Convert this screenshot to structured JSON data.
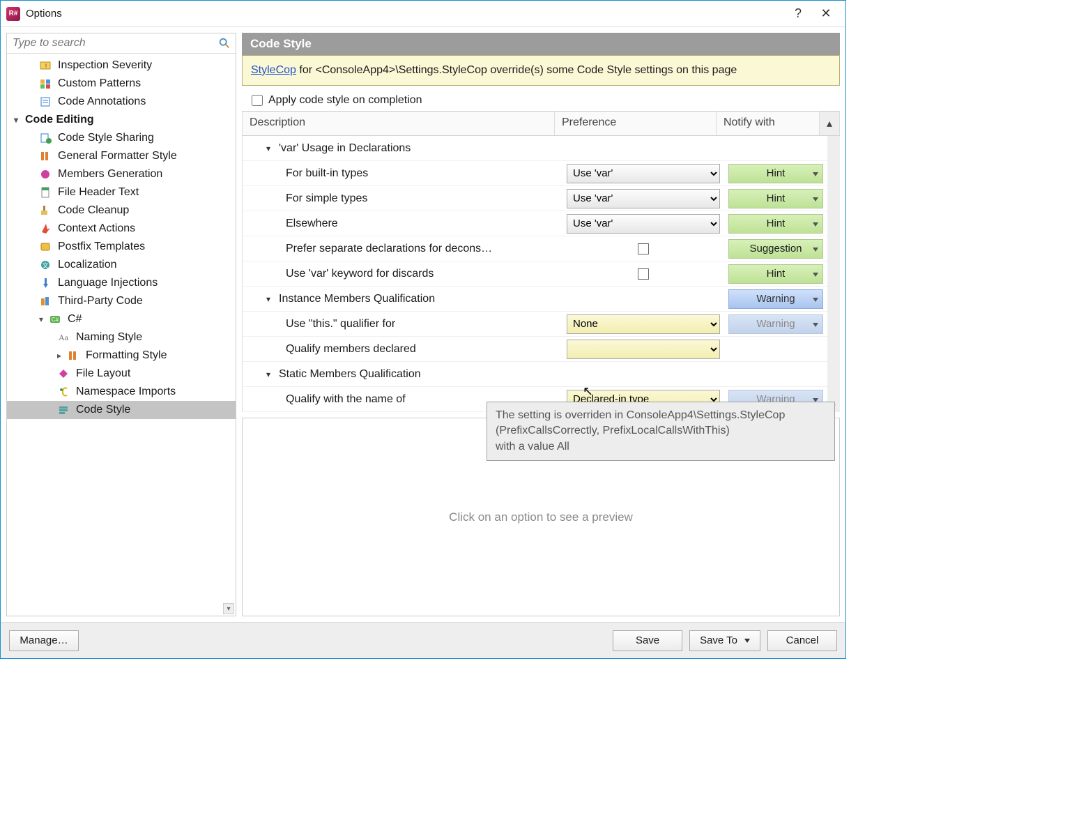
{
  "window": {
    "title": "Options"
  },
  "titlebar": {
    "help": "?",
    "close": "✕"
  },
  "search": {
    "placeholder": "Type to search"
  },
  "tree": {
    "items": [
      {
        "level": 1,
        "label": "Inspection Severity"
      },
      {
        "level": 1,
        "label": "Custom Patterns"
      },
      {
        "level": 1,
        "label": "Code Annotations"
      },
      {
        "group": true,
        "label": "Code Editing",
        "expanded": true
      },
      {
        "level": 1,
        "label": "Code Style Sharing"
      },
      {
        "level": 1,
        "label": "General Formatter Style"
      },
      {
        "level": 1,
        "label": "Members Generation"
      },
      {
        "level": 1,
        "label": "File Header Text"
      },
      {
        "level": 1,
        "label": "Code Cleanup"
      },
      {
        "level": 1,
        "label": "Context Actions"
      },
      {
        "level": 1,
        "label": "Postfix Templates"
      },
      {
        "level": 1,
        "label": "Localization"
      },
      {
        "level": 1,
        "label": "Language Injections"
      },
      {
        "level": 1,
        "label": "Third-Party Code"
      },
      {
        "level": 1,
        "label": "C#",
        "expandable": true,
        "expanded": true
      },
      {
        "level": 2,
        "label": "Naming Style"
      },
      {
        "level": 2,
        "label": "Formatting Style",
        "expandable": true,
        "expanded": false
      },
      {
        "level": 2,
        "label": "File Layout"
      },
      {
        "level": 2,
        "label": "Namespace Imports"
      },
      {
        "level": 2,
        "label": "Code Style",
        "selected": true
      }
    ]
  },
  "main": {
    "title": "Code Style",
    "banner": {
      "link": "StyleCop",
      "text_after": " for <ConsoleApp4>\\Settings.StyleCop override(s) some Code Style settings on this page"
    },
    "apply_label": "Apply code style on completion",
    "columns": {
      "desc": "Description",
      "pref": "Preference",
      "notif": "Notify with"
    },
    "rows": [
      {
        "type": "section",
        "desc": "'var' Usage in Declarations"
      },
      {
        "type": "opt",
        "desc": "For built-in types",
        "pref_select": "Use 'var'",
        "notif": "Hint",
        "notif_kind": "hint"
      },
      {
        "type": "opt",
        "desc": "For simple types",
        "pref_select": "Use 'var'",
        "notif": "Hint",
        "notif_kind": "hint"
      },
      {
        "type": "opt",
        "desc": "Elsewhere",
        "pref_select": "Use 'var'",
        "notif": "Hint",
        "notif_kind": "hint"
      },
      {
        "type": "chk",
        "desc": "Prefer separate declarations for decons…",
        "notif": "Suggestion",
        "notif_kind": "hint"
      },
      {
        "type": "chk",
        "desc": "Use 'var' keyword for discards",
        "notif": "Hint",
        "notif_kind": "hint"
      },
      {
        "type": "section",
        "desc": "Instance Members Qualification",
        "notif": "Warning",
        "notif_kind": "warning"
      },
      {
        "type": "opt",
        "desc": "Use \"this.\" qualifier for",
        "pref_select": "None",
        "overridden": true,
        "notif": "Warning",
        "notif_kind": "warning-dim"
      },
      {
        "type": "opt",
        "desc": "Qualify members declared",
        "pref_select": "",
        "overridden": true
      },
      {
        "type": "section",
        "desc": "Static Members Qualification"
      },
      {
        "type": "opt",
        "desc": "Qualify with the name of",
        "pref_select": "Declared-in type",
        "overridden": true,
        "notif": "Warning",
        "notif_kind": "warning-dim"
      }
    ],
    "preview_text": "Click on an option to see a preview"
  },
  "tooltip": {
    "line1": "The setting is overriden in ConsoleApp4\\Settings.StyleCop",
    "line2": "(PrefixCallsCorrectly, PrefixLocalCallsWithThis)",
    "line3": "with a value All"
  },
  "footer": {
    "manage": "Manage…",
    "save": "Save",
    "save_to": "Save To",
    "cancel": "Cancel"
  }
}
